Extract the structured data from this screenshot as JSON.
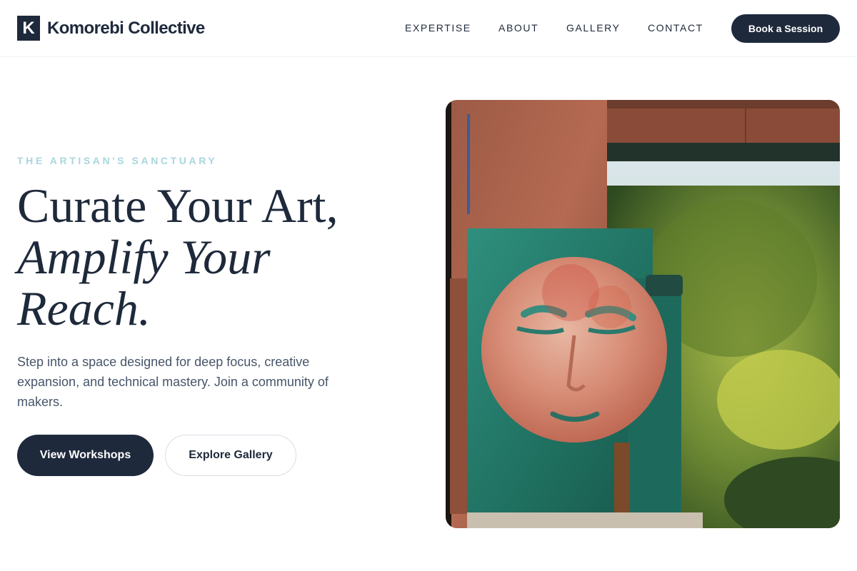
{
  "brand": {
    "mark": "K",
    "name": "Komorebi Collective"
  },
  "nav": {
    "items": [
      "EXPERTISE",
      "ABOUT",
      "GALLERY",
      "CONTACT"
    ],
    "cta": "Book a Session"
  },
  "hero": {
    "eyebrow": "THE ARTISAN'S SANCTUARY",
    "headline_line1": "Curate Your Art,",
    "headline_line2": "Amplify Your",
    "headline_line3": "Reach.",
    "description": "Step into a space designed for deep focus, creative expansion, and technical mastery. Join a community of makers.",
    "primary_button": "View Workshops",
    "secondary_button": "Explore Gallery"
  },
  "image": {
    "subject": "painted-moon-face-panel-outdoors"
  },
  "colors": {
    "primary": "#1e293b",
    "eyebrow": "#a9d6df",
    "body_text": "#475569"
  }
}
